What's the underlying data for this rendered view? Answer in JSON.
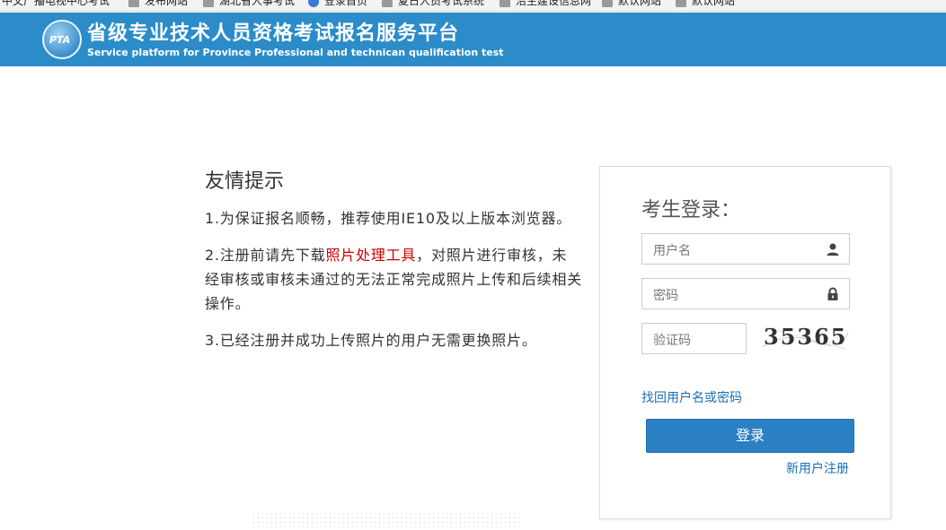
{
  "bookmarks": [
    {
      "label": "中文广播电视中心考试",
      "icon": "page-icon"
    },
    {
      "label": "发布网站",
      "icon": "page-icon"
    },
    {
      "label": "湖北省人事考试",
      "icon": "page-icon"
    },
    {
      "label": "登录首页",
      "icon": "globe-icon"
    },
    {
      "label": "夏日人员考试系统",
      "icon": "page-icon"
    },
    {
      "label": "沿主建设信息网",
      "icon": "page-icon"
    },
    {
      "label": "默认网站",
      "icon": "page-icon"
    },
    {
      "label": "默认网站",
      "icon": "page-icon"
    }
  ],
  "header": {
    "logo_text": "PTA",
    "title_cn": "省级专业技术人员资格考试报名服务平台",
    "title_en": "Service platform for Province Professional and technican qualification test",
    "bg_color": "#2b8cc9"
  },
  "tips": {
    "title": "友情提示",
    "item1": "1.为保证报名顺畅，推荐使用IE10及以上版本浏览器。",
    "item2_before": "2.注册前请先下载",
    "item2_link": "照片处理工具",
    "item2_after": "，对照片进行审核，未经审核或审核未通过的无法正常完成照片上传和后续相关操作。",
    "item3": "3.已经注册并成功上传照片的用户无需更换照片。"
  },
  "login": {
    "title": "考生登录：",
    "username_placeholder": "用户名",
    "password_placeholder": "密码",
    "captcha_placeholder": "验证码",
    "captcha_text": "35365",
    "forgot_link": "找回用户名或密码",
    "login_button": "登录",
    "register_link": "新用户注册",
    "accent_color": "#2b7fc3"
  }
}
